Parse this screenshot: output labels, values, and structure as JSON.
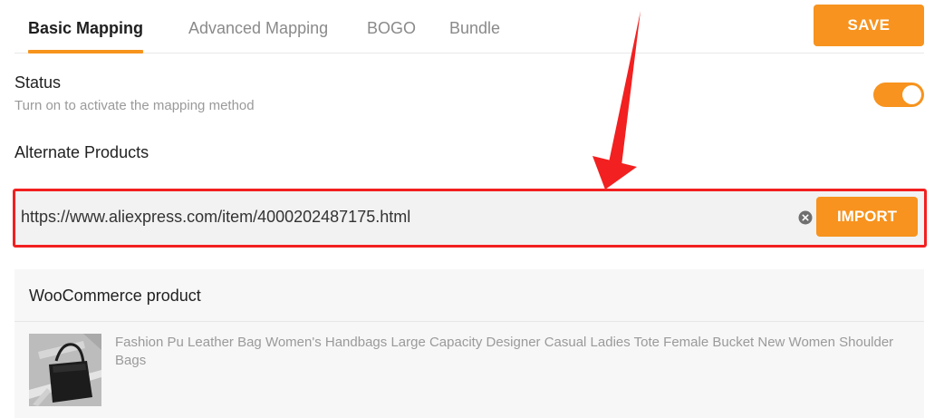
{
  "tabs": [
    {
      "label": "Basic Mapping",
      "active": true
    },
    {
      "label": "Advanced Mapping",
      "active": false
    },
    {
      "label": "BOGO",
      "active": false
    },
    {
      "label": "Bundle",
      "active": false
    }
  ],
  "toolbar": {
    "save_label": "SAVE"
  },
  "status": {
    "title": "Status",
    "subtitle": "Turn on to activate the mapping method",
    "enabled": true
  },
  "alternate_products": {
    "title": "Alternate Products",
    "url_value": "https://www.aliexpress.com/item/4000202487175.html",
    "import_label": "IMPORT"
  },
  "woocommerce": {
    "title": "WooCommerce product",
    "product_title": "Fashion Pu Leather Bag Women's Handbags Large Capacity Designer Casual Ladies Tote Female Bucket New Women Shoulder Bags"
  },
  "colors": {
    "accent": "#f7931e",
    "highlight": "#f22020"
  },
  "icons": {
    "clear": "clear-icon",
    "annotation": "red-arrow-icon"
  }
}
